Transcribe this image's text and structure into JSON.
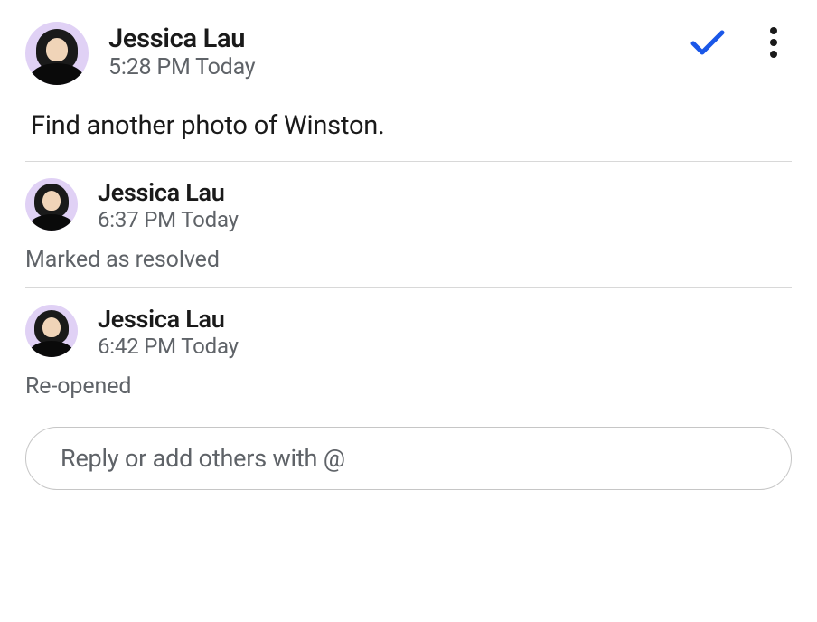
{
  "colors": {
    "accent_blue": "#1a73e8",
    "text_primary": "#1a1a1a",
    "text_secondary": "#5f6368"
  },
  "comments": [
    {
      "author": "Jessica Lau",
      "timestamp": "5:28 PM Today",
      "body": "Find another photo of Winston.",
      "show_actions": true
    },
    {
      "author": "Jessica Lau",
      "timestamp": "6:37 PM Today",
      "status": "Marked as resolved"
    },
    {
      "author": "Jessica Lau",
      "timestamp": "6:42 PM Today",
      "status": "Re-opened"
    }
  ],
  "reply_placeholder": "Reply or add others with @"
}
